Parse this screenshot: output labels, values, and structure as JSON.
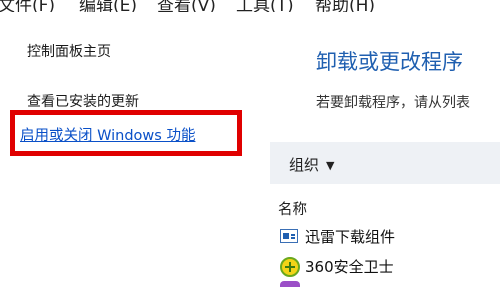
{
  "menubar": {
    "items": [
      "文件(F)",
      "编辑(E)",
      "查看(V)",
      "工具(T)",
      "帮助(H)"
    ]
  },
  "sidebar": {
    "home": "控制面板主页",
    "installed_updates": "查看已安装的更新",
    "windows_features": "启用或关闭 Windows 功能"
  },
  "main": {
    "title": "卸载或更改程序",
    "description": "若要卸载程序，请从列表"
  },
  "toolbar": {
    "organize_label": "组织"
  },
  "list": {
    "column_name": "名称",
    "programs": [
      {
        "name": "迅雷下载组件",
        "icon": "window-icon"
      },
      {
        "name": "360安全卫士",
        "icon": "360-shield-icon"
      }
    ]
  },
  "colors": {
    "highlight_border": "#e00000",
    "link": "#0a50c8",
    "title": "#1f5fb0"
  }
}
